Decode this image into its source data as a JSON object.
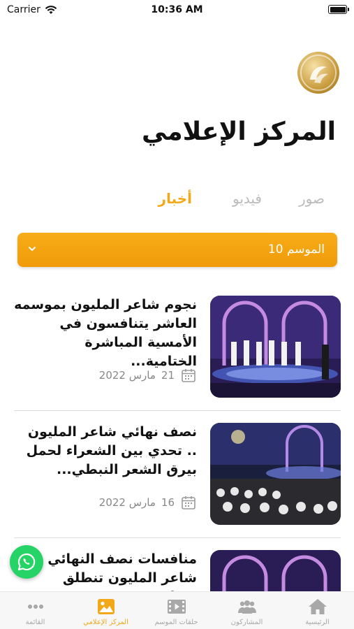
{
  "status": {
    "carrier": "Carrier",
    "time": "10:36 AM"
  },
  "header": {
    "title": "المركز الإعلامي",
    "logo_icon": "million-poet-logo"
  },
  "tabs": [
    {
      "label": "أخبار",
      "active": true
    },
    {
      "label": "فيديو",
      "active": false
    },
    {
      "label": "صور",
      "active": false
    }
  ],
  "season_select": {
    "value": "الموسم 10"
  },
  "articles": [
    {
      "headline": "نجوم شاعر المليون بموسمه العاشر يتنافسون في الأمسية المباشرة الختامية...",
      "day": "21",
      "month_year": "مارس 2022"
    },
    {
      "headline": "نصف نهائي شاعر المليون .. تحدي بين الشعراء لحمل بيرق الشعر النبطي...",
      "day": "16",
      "month_year": "مارس 2022"
    },
    {
      "headline": "منافسات نصف النهائي شاعر المليون تنطلق مساء...",
      "day": "",
      "month_year": ""
    }
  ],
  "tabbar": {
    "menu": "القائمة",
    "media_center": "المركز الإعلامي",
    "episodes": "حلقات الموسم",
    "participants": "المشاركون",
    "home": "الرئيسية"
  },
  "colors": {
    "accent": "#f2a818",
    "whatsapp": "#25d366",
    "inactive": "#a8a8a8"
  }
}
